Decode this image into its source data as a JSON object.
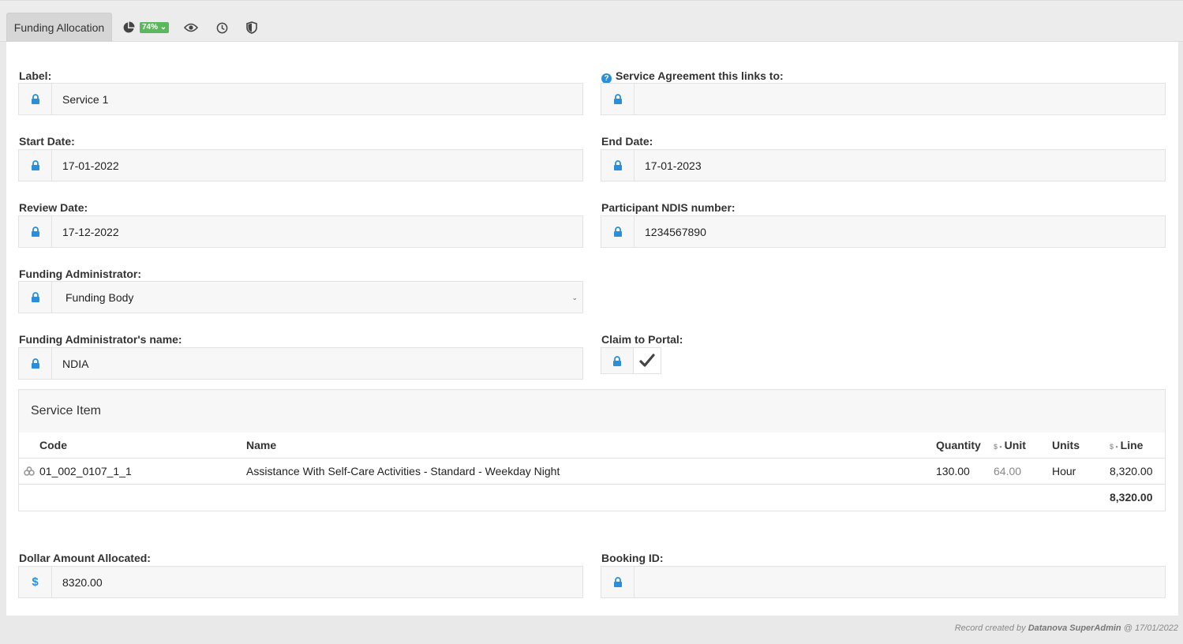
{
  "tabs": {
    "active": "Funding Allocation",
    "badge": "74%"
  },
  "form": {
    "label": {
      "caption": "Label:",
      "value": "Service 1"
    },
    "service_agreement": {
      "caption": "Service Agreement this links to:",
      "value": ""
    },
    "start_date": {
      "caption": "Start Date:",
      "value": "17-01-2022"
    },
    "end_date": {
      "caption": "End Date:",
      "value": "17-01-2023"
    },
    "review_date": {
      "caption": "Review Date:",
      "value": "17-12-2022"
    },
    "ndis_number": {
      "caption": "Participant NDIS number:",
      "value": "1234567890"
    },
    "funding_admin": {
      "caption": "Funding Administrator:",
      "value": "Funding Body"
    },
    "funding_admin_name": {
      "caption": "Funding Administrator's name:",
      "value": "NDIA"
    },
    "claim_to_portal": {
      "caption": "Claim to Portal:",
      "checked": true
    },
    "dollar_amount": {
      "caption": "Dollar Amount Allocated:",
      "value": "8320.00",
      "prefix": "$"
    },
    "booking_id": {
      "caption": "Booking ID:",
      "value": ""
    }
  },
  "service_item": {
    "title": "Service Item",
    "headers": {
      "code": "Code",
      "name": "Name",
      "quantity": "Quantity",
      "unit": "Unit",
      "units": "Units",
      "line": "Line",
      "currency_prefix": "$ •"
    },
    "rows": [
      {
        "code": "01_002_0107_1_1",
        "name": "Assistance With Self-Care Activities - Standard - Weekday Night",
        "quantity": "130.00",
        "unit": "64.00",
        "units": "Hour",
        "line": "8,320.00"
      }
    ],
    "total": "8,320.00"
  },
  "footer": {
    "prefix": "Record created by",
    "user": "Datanova SuperAdmin",
    "date": "@ 17/01/2022"
  },
  "colors": {
    "accent": "#2a8fd8",
    "badge": "#5cb85c"
  }
}
